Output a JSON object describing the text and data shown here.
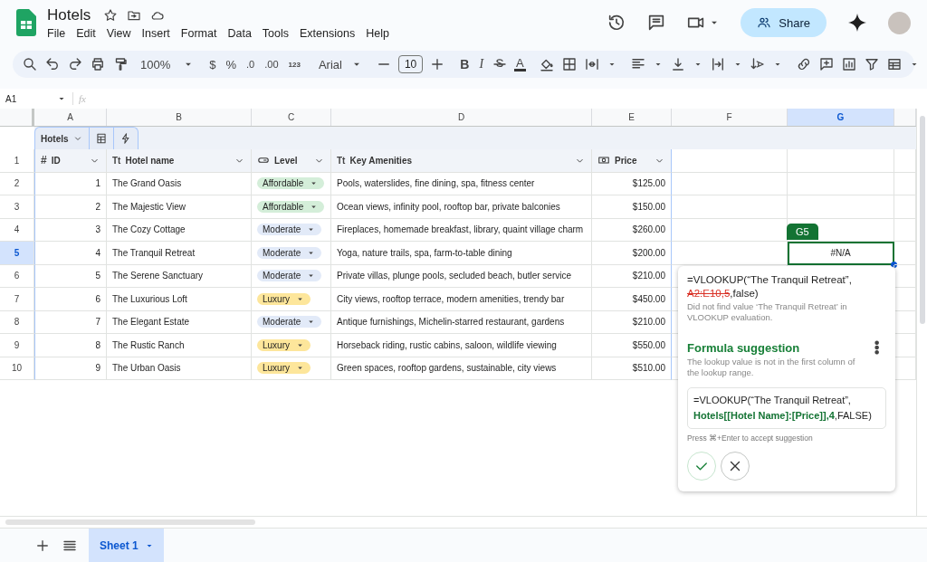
{
  "app": {
    "title": "Hotels",
    "menus": [
      "File",
      "Edit",
      "View",
      "Insert",
      "Format",
      "Data",
      "Tools",
      "Extensions",
      "Help"
    ],
    "share_label": "Share"
  },
  "toolbar": {
    "zoom": "100%",
    "currency": "$",
    "percent": "%",
    "decrease_decimal": ".0",
    "increase_decimal": ".00",
    "number_format": "123",
    "font": "Arial",
    "font_size": "10",
    "bold": "B",
    "italic": "I",
    "text_color": "A"
  },
  "formula_bar": {
    "name_box": "A1",
    "fx": "fx"
  },
  "columns": [
    {
      "letter": "A",
      "selected": false
    },
    {
      "letter": "B",
      "selected": false
    },
    {
      "letter": "C",
      "selected": false
    },
    {
      "letter": "D",
      "selected": false
    },
    {
      "letter": "E",
      "selected": false
    },
    {
      "letter": "F",
      "selected": false
    },
    {
      "letter": "G",
      "selected": true
    }
  ],
  "row_numbers": [
    {
      "label": "1",
      "selected": false
    },
    {
      "label": "2",
      "selected": false
    },
    {
      "label": "3",
      "selected": false
    },
    {
      "label": "4",
      "selected": false
    },
    {
      "label": "5",
      "selected": true
    },
    {
      "label": "6",
      "selected": false
    },
    {
      "label": "7",
      "selected": false
    },
    {
      "label": "8",
      "selected": false
    },
    {
      "label": "9",
      "selected": false
    },
    {
      "label": "10",
      "selected": false
    }
  ],
  "table": {
    "name": "Hotels",
    "headers": [
      {
        "label": "ID",
        "kind": "number",
        "glyph": "#"
      },
      {
        "label": "Hotel name",
        "kind": "text",
        "glyph": "Tt"
      },
      {
        "label": "Level",
        "kind": "dropdown"
      },
      {
        "label": "Key Amenities",
        "kind": "text",
        "glyph": "Tt"
      },
      {
        "label": "Price",
        "kind": "currency"
      }
    ],
    "rows": [
      {
        "id": "1",
        "name": "The Grand Oasis",
        "level": {
          "label": "Affordable",
          "color": "#d4eed9"
        },
        "amenities": "Pools, waterslides, fine dining, spa, fitness center",
        "price": "$125.00"
      },
      {
        "id": "2",
        "name": "The Majestic View",
        "level": {
          "label": "Affordable",
          "color": "#d4eed9"
        },
        "amenities": "Ocean views, infinity pool, rooftop bar, private balconies",
        "price": "$150.00"
      },
      {
        "id": "3",
        "name": "The Cozy Cottage",
        "level": {
          "label": "Moderate",
          "color": "#e2eaf8"
        },
        "amenities": "Fireplaces, homemade breakfast, library, quaint village charm",
        "price": "$260.00"
      },
      {
        "id": "4",
        "name": "The Tranquil Retreat",
        "level": {
          "label": "Moderate",
          "color": "#e2eaf8"
        },
        "amenities": "Yoga, nature trails, spa, farm-to-table dining",
        "price": "$200.00"
      },
      {
        "id": "5",
        "name": "The Serene Sanctuary",
        "level": {
          "label": "Moderate",
          "color": "#e2eaf8"
        },
        "amenities": "Private villas, plunge pools, secluded beach, butler service",
        "price": "$210.00"
      },
      {
        "id": "6",
        "name": "The Luxurious Loft",
        "level": {
          "label": "Luxury",
          "color": "#fde69b"
        },
        "amenities": "City views, rooftop terrace, modern amenities, trendy bar",
        "price": "$450.00"
      },
      {
        "id": "7",
        "name": "The Elegant Estate",
        "level": {
          "label": "Moderate",
          "color": "#e2eaf8"
        },
        "amenities": "Antique furnishings, Michelin-starred restaurant, gardens",
        "price": "$210.00"
      },
      {
        "id": "8",
        "name": "The Rustic Ranch",
        "level": {
          "label": "Luxury",
          "color": "#fde69b"
        },
        "amenities": "Horseback riding, rustic cabins, saloon, wildlife viewing",
        "price": "$550.00"
      },
      {
        "id": "9",
        "name": "The Urban Oasis",
        "level": {
          "label": "Luxury",
          "color": "#fde69b"
        },
        "amenities": "Green spaces, rooftop gardens, sustainable, city views",
        "price": "$510.00"
      }
    ]
  },
  "active_cell": {
    "reference": "G5",
    "value": "#N/A"
  },
  "popup": {
    "formula": [
      {
        "text": "=VLOOKUP(“The Tranquil Retreat”, ",
        "kind": "plain"
      },
      {
        "text": "A2:E10,5",
        "kind": "error"
      },
      {
        "text": ",false)",
        "kind": "plain"
      }
    ],
    "error_message": "Did not find value ‘The Tranquil Retreat’ in VLOOKUP evaluation.",
    "suggestion_title": "Formula suggestion",
    "suggestion_text": "The lookup value is not in the first column of the lookup range.",
    "suggested_formula": [
      {
        "text": "=VLOOKUP(“The Tranquil Retreat”, ",
        "kind": "plain"
      },
      {
        "text": "Hotels[[Hotel Name]:[Price]],4",
        "kind": "fix"
      },
      {
        "text": ",FALSE)",
        "kind": "plain"
      }
    ],
    "hint": "Press ⌘+Enter to accept suggestion"
  },
  "sheet_tabs": [
    {
      "label": "Sheet 1",
      "selected": true
    }
  ]
}
